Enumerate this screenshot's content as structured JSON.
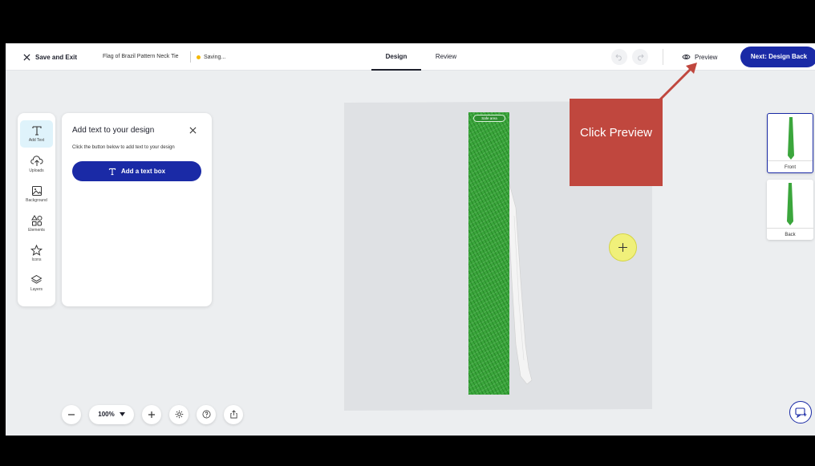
{
  "topbar": {
    "exit_label": "Save and Exit",
    "doc_title": "Flag of Brazil Pattern Neck Tie",
    "saving_label": "Saving...",
    "tabs": [
      {
        "label": "Design",
        "active": true
      },
      {
        "label": "Review",
        "active": false
      }
    ],
    "preview_label": "Preview",
    "next_label": "Next: Design Back"
  },
  "tools": [
    {
      "label": "Add Text",
      "icon": "text-icon",
      "active": true
    },
    {
      "label": "Uploads",
      "icon": "cloud-upload-icon",
      "active": false
    },
    {
      "label": "Background",
      "icon": "image-icon",
      "active": false
    },
    {
      "label": "Elements",
      "icon": "shapes-icon",
      "active": false
    },
    {
      "label": "Icons",
      "icon": "star-icon",
      "active": false
    },
    {
      "label": "Layers",
      "icon": "layers-icon",
      "active": false
    }
  ],
  "panel": {
    "title": "Add text to your design",
    "description": "Click the button below to add text to your design",
    "add_button_label": "Add a text box"
  },
  "canvas": {
    "safe_area_label": "Safe area",
    "tie_color": "#3ba63c"
  },
  "annotation": {
    "text": "Click Preview",
    "color": "#c0473e"
  },
  "thumbnails": [
    {
      "label": "Front",
      "selected": true
    },
    {
      "label": "Back",
      "selected": false
    }
  ],
  "zoom": {
    "level": "100%"
  },
  "colors": {
    "accent": "#1a2aa6",
    "saving_dot": "#f5b800"
  }
}
